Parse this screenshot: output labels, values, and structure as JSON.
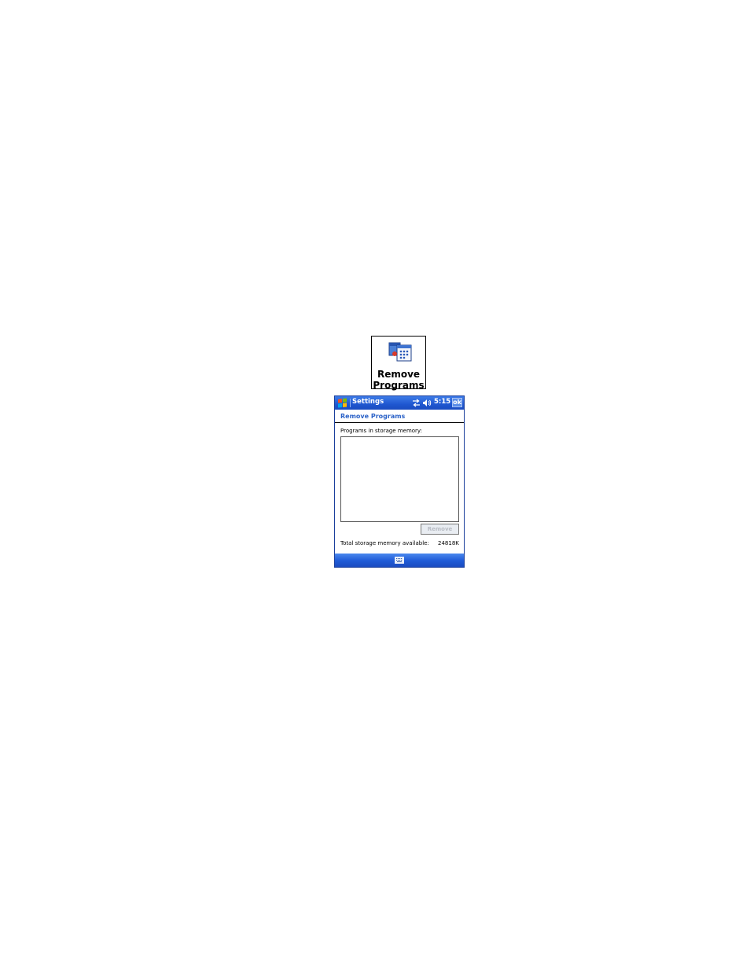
{
  "icon_tile": {
    "label_line1": "Remove",
    "label_line2": "Programs",
    "icon": "remove-programs-icon"
  },
  "device": {
    "titlebar": {
      "app_title": "Settings",
      "clock": "5:15",
      "ok_label": "ok",
      "icons": [
        "start-flag-icon",
        "connectivity-icon",
        "volume-icon"
      ]
    },
    "page_title": "Remove Programs",
    "list_label": "Programs in storage memory:",
    "programs": [],
    "remove_button_label": "Remove",
    "memory": {
      "label": "Total storage memory available:",
      "value": "24818K"
    },
    "menubar": {
      "icon": "keyboard-icon"
    },
    "colors": {
      "titlebar": "#1f57d0",
      "accent_text": "#2c63c8"
    }
  }
}
